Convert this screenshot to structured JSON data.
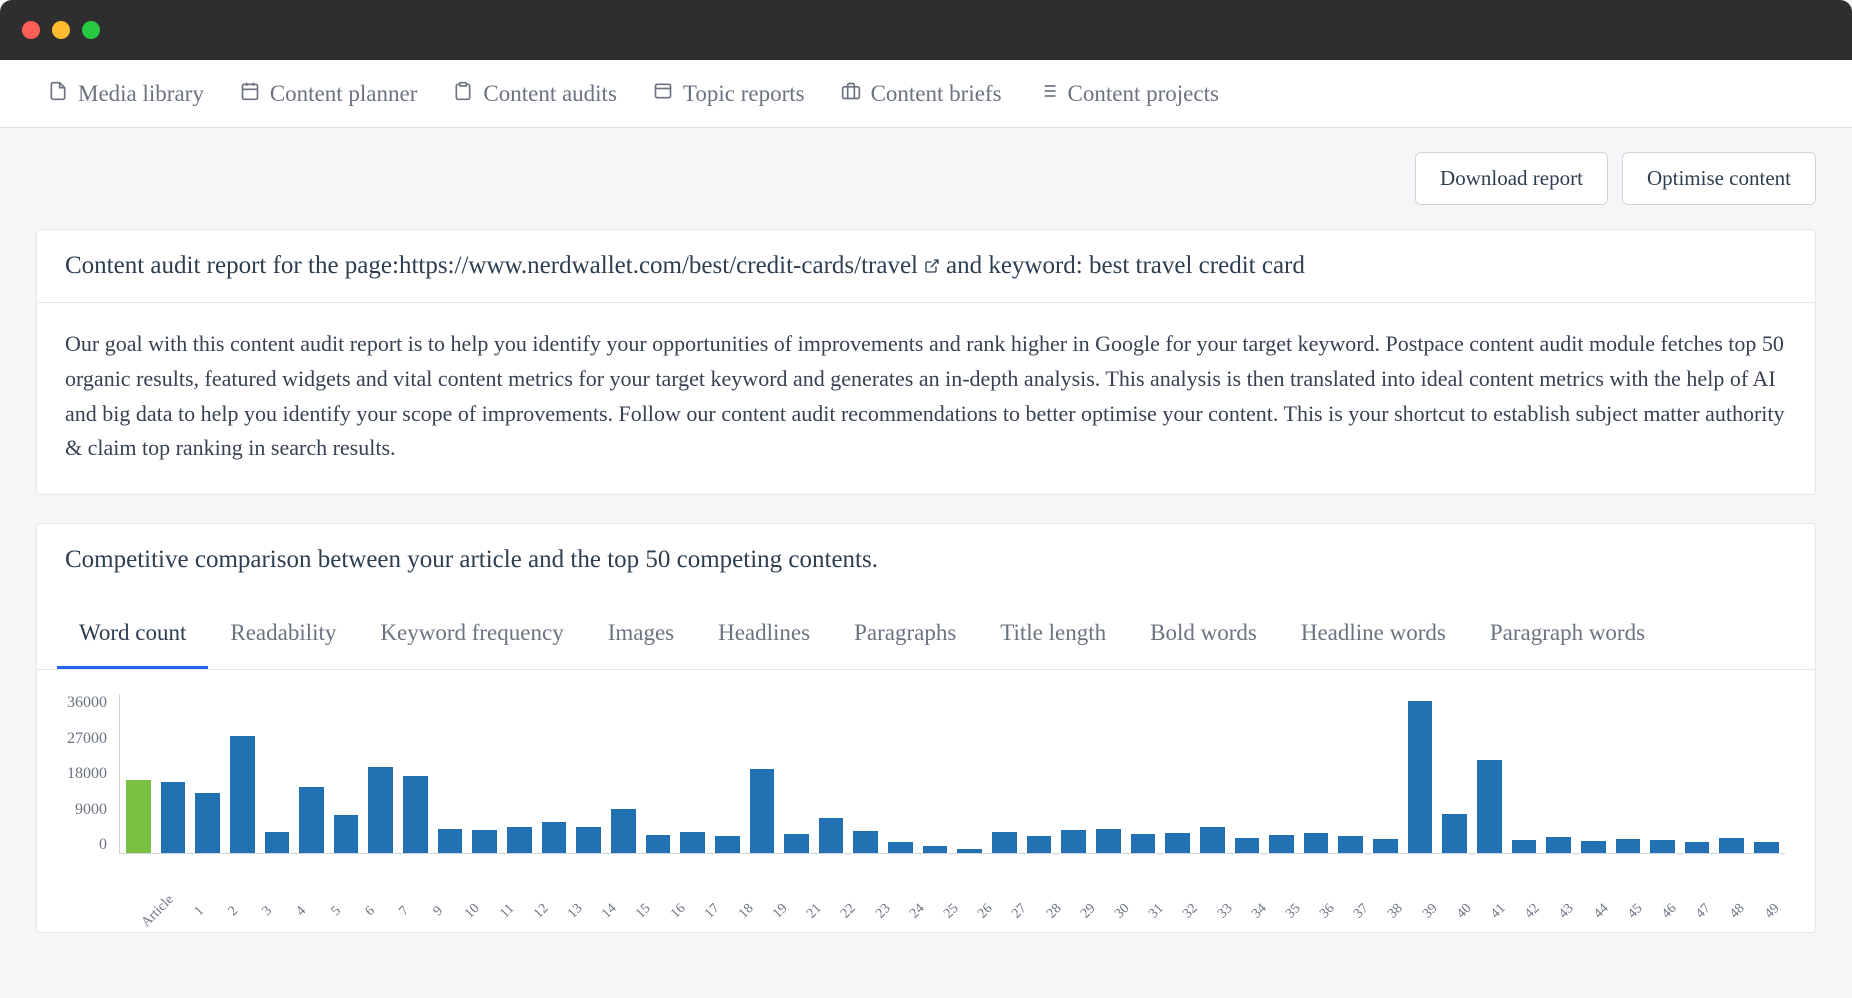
{
  "nav": [
    {
      "label": "Media library",
      "icon": "file"
    },
    {
      "label": "Content planner",
      "icon": "calendar"
    },
    {
      "label": "Content audits",
      "icon": "clipboard"
    },
    {
      "label": "Topic reports",
      "icon": "browser"
    },
    {
      "label": "Content briefs",
      "icon": "briefcase"
    },
    {
      "label": "Content projects",
      "icon": "list"
    }
  ],
  "actions": {
    "download": "Download report",
    "optimise": "Optimise content"
  },
  "report_header": {
    "prefix": "Content audit report for the page: ",
    "url": "https://www.nerdwallet.com/best/credit-cards/travel",
    "suffix": " and keyword: best travel credit card"
  },
  "intro": "Our goal with this content audit report is to help you identify your opportunities of improvements and rank higher in Google for your target keyword. Postpace content audit module fetches top 50 organic results, featured widgets and vital content metrics for your target keyword and generates an in-depth analysis. This analysis is then translated into ideal content metrics with the help of AI and big data to help you identify your scope of improvements. Follow our content audit recommendations to better optimise your content. This is your shortcut to establish subject matter authority & claim top ranking in search results.",
  "comparison_title": "Competitive comparison between your article and the top 50 competing contents.",
  "tabs": [
    "Word count",
    "Readability",
    "Keyword frequency",
    "Images",
    "Headlines",
    "Paragraphs",
    "Title length",
    "Bold words",
    "Headline words",
    "Paragraph words"
  ],
  "active_tab": 0,
  "chart_data": {
    "type": "bar",
    "title": "",
    "xlabel": "",
    "ylabel": "",
    "ylim": [
      0,
      36000
    ],
    "y_ticks": [
      0,
      9000,
      18000,
      27000,
      36000
    ],
    "categories": [
      "Article",
      "1",
      "2",
      "3",
      "4",
      "5",
      "6",
      "7",
      "9",
      "10",
      "11",
      "12",
      "13",
      "14",
      "15",
      "16",
      "17",
      "18",
      "19",
      "21",
      "22",
      "23",
      "24",
      "25",
      "26",
      "27",
      "28",
      "29",
      "30",
      "31",
      "32",
      "33",
      "34",
      "35",
      "36",
      "37",
      "38",
      "39",
      "40",
      "41",
      "42",
      "43",
      "44",
      "45",
      "46",
      "47",
      "48",
      "49"
    ],
    "values": [
      16500,
      16000,
      13500,
      26500,
      4800,
      15000,
      8500,
      19500,
      17500,
      5500,
      5200,
      6000,
      7000,
      6000,
      10000,
      4000,
      4800,
      3800,
      19000,
      4200,
      8000,
      5000,
      2600,
      1700,
      900,
      4800,
      3800,
      5200,
      5500,
      4400,
      4600,
      5800,
      3400,
      4000,
      4600,
      3800,
      3200,
      34500,
      8800,
      21000,
      3000,
      3600,
      2800,
      3200,
      3000,
      2400,
      3500,
      2600
    ],
    "highlight_index": 0
  }
}
